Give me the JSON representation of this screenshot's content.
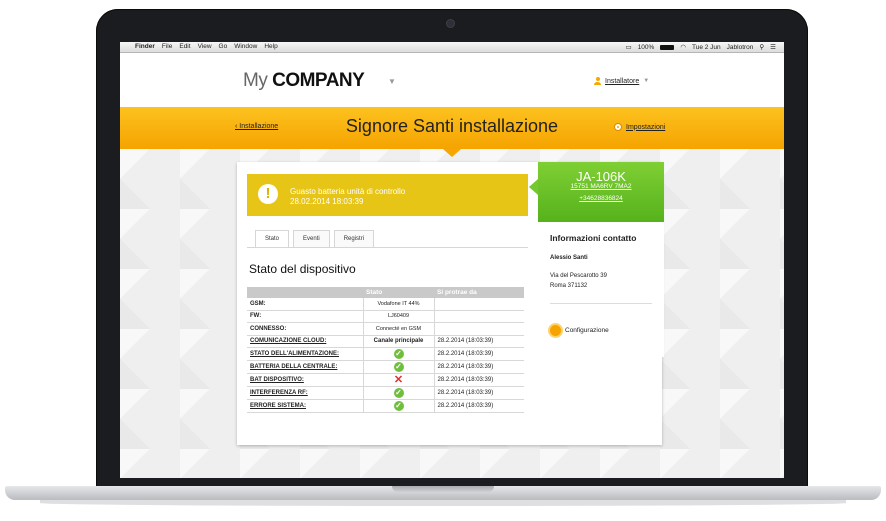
{
  "menubar": {
    "apple": "",
    "items": [
      "Finder",
      "File",
      "Edit",
      "View",
      "Go",
      "Window",
      "Help"
    ],
    "battery": "100%",
    "clock": "Tue 2 Jun",
    "user": "Jablotron"
  },
  "header": {
    "logo_my": "My",
    "logo_company": "COMPANY",
    "logo_caret": "▼",
    "user_label": "Installatore",
    "user_caret": "▼"
  },
  "band": {
    "back_link": "‹ Installazione",
    "title": "Signore Santi installazione",
    "settings_link": "Impostazioni"
  },
  "alert": {
    "icon": "!",
    "line1": "Guasto batteria unità di controllo",
    "line2": "28.02.2014 18:03:39"
  },
  "tabs": [
    "Stato",
    "Eventi",
    "Registri"
  ],
  "section_title": "Stato del dispositivo",
  "table": {
    "headers": [
      "",
      "Stato",
      "Si protrae da"
    ],
    "rows": [
      {
        "label": "GSM:",
        "stato": "Vodafone IT 44%",
        "since": ""
      },
      {
        "label": "FW:",
        "stato": "LJ60409",
        "since": ""
      },
      {
        "label": "CONNESSO:",
        "stato": "Connecté en GSM",
        "since": ""
      },
      {
        "label": "COMUNICAZIONE CLOUD:",
        "stato": "Canale principale",
        "since": "28.2.2014 (18:03:39)"
      },
      {
        "label": "STATO DELL'ALIMENTAZIONE:",
        "stato": "ok",
        "since": "28.2.2014 (18:03:39)"
      },
      {
        "label": "BATTERIA DELLA CENTRALE:",
        "stato": "ok",
        "since": "28.2.2014 (18:03:39)"
      },
      {
        "label": "BAT DISPOSITIVO:",
        "stato": "error",
        "since": "28.2.2014 (18:03:39)"
      },
      {
        "label": "INTERFERENZA RF:",
        "stato": "ok",
        "since": "28.2.2014 (18:03:39)"
      },
      {
        "label": "ERRORE SISTEMA:",
        "stato": "ok",
        "since": "28.2.2014 (18:03:39)"
      }
    ]
  },
  "device": {
    "name": "JA-106K",
    "serial": "15751 MA6RV 7MA2",
    "phone": "+34628836824"
  },
  "contact": {
    "heading": "Informazioni contatto",
    "name": "Alessio Santi",
    "address1": "Via del Pescarotto 39",
    "address2": "Roma 371132",
    "config_link": "Configurazione"
  },
  "colors": {
    "accent": "#f5a300",
    "alert": "#e6c516",
    "device": "#63bd24",
    "ok": "#6fbf3c",
    "error": "#e2302c"
  }
}
